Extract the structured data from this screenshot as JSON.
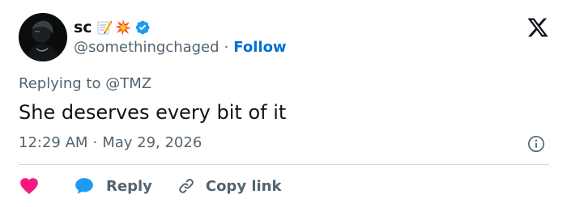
{
  "user": {
    "display_name": "sc",
    "name_emojis": [
      "memo-icon",
      "collision-icon"
    ],
    "verified": true,
    "handle": "@somethingchaged",
    "separator": "·",
    "follow_label": "Follow"
  },
  "tweet": {
    "replying_prefix": "Replying to",
    "replying_to": "@TMZ",
    "text": "She deserves every bit of it",
    "time": "12:29 AM",
    "time_separator": "·",
    "date": "May 29, 2026"
  },
  "actions": {
    "reply_label": "Reply",
    "copy_link_label": "Copy link"
  },
  "colors": {
    "text_primary": "#0f1419",
    "text_secondary": "#536471",
    "accent_blue": "#006fd6",
    "verified_blue": "#1d9bf0",
    "heart_pink": "#f91880",
    "divider": "#cfd9de"
  },
  "icons": {
    "logo": "x-logo-icon",
    "info": "info-icon",
    "like": "heart-icon",
    "reply": "reply-bubble-icon",
    "copy_link": "link-icon",
    "verified": "verified-badge-icon"
  }
}
